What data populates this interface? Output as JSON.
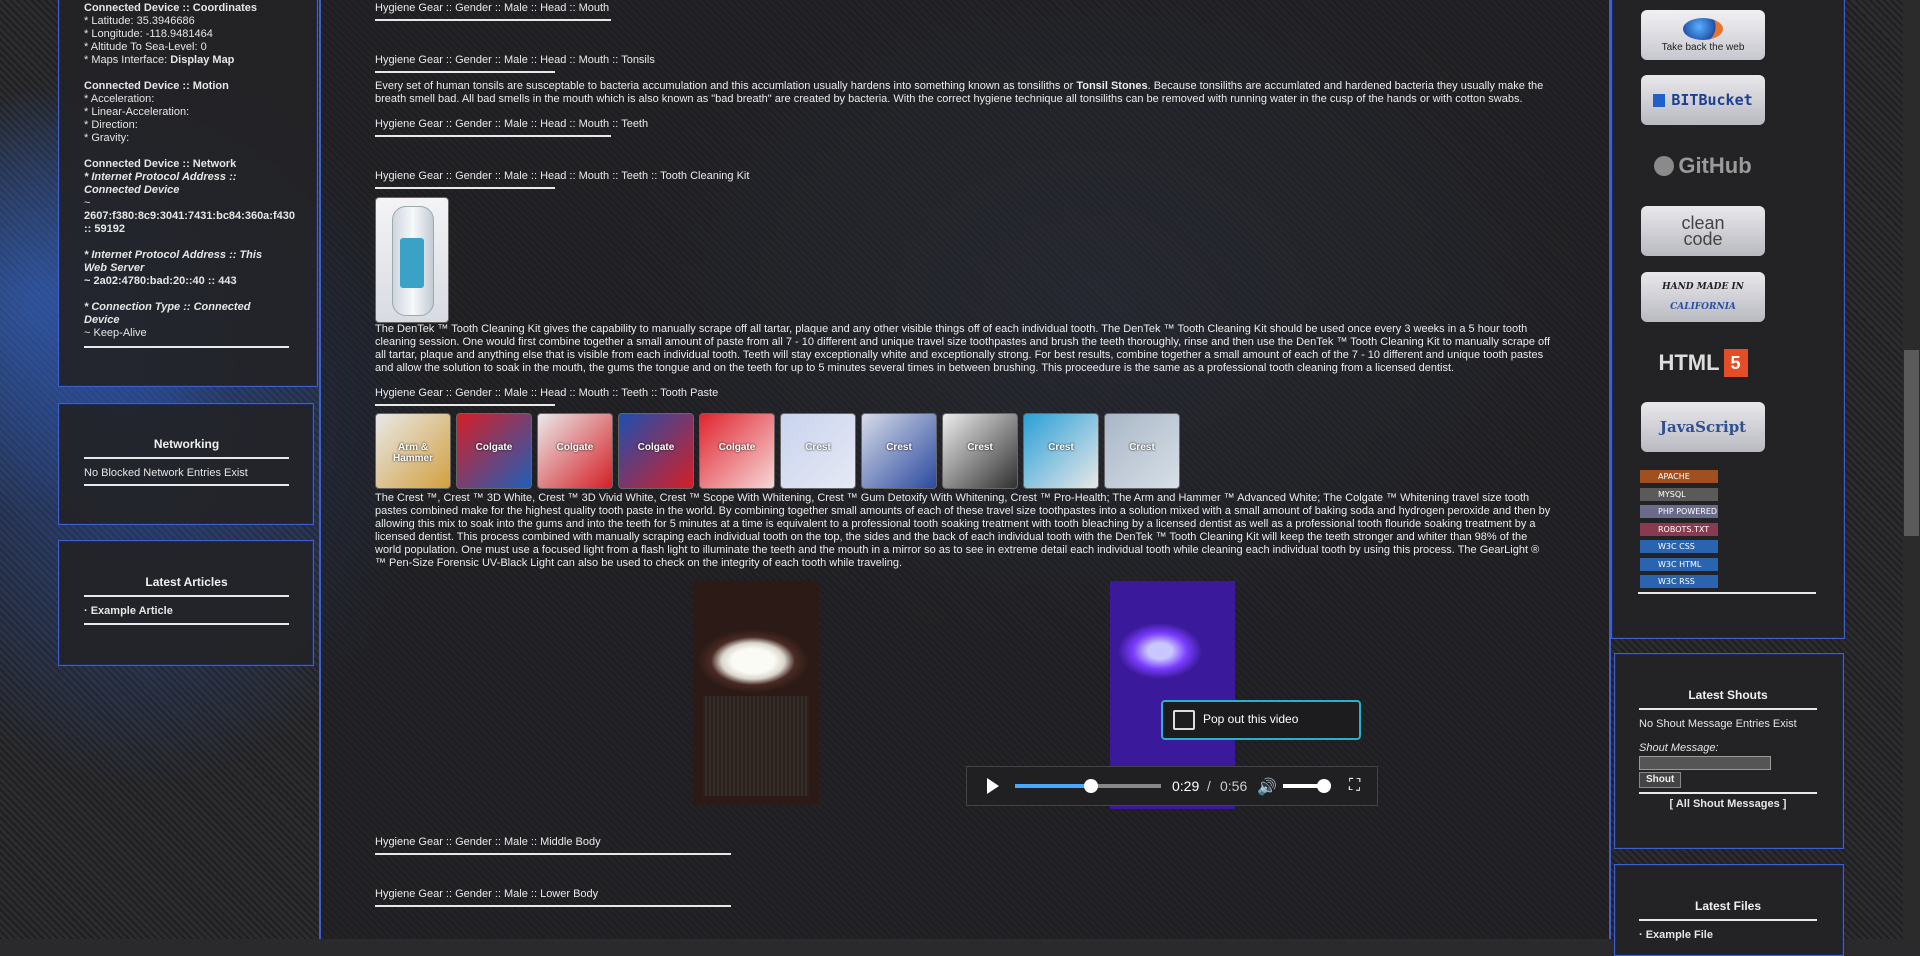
{
  "left": {
    "coords": {
      "title": "Connected Device :: Coordinates",
      "lat": "* Latitude: 35.3946686",
      "lon": "* Longitude: -118.9481464",
      "alt": "* Altitude To Sea-Level: 0",
      "maps_prefix": "* Maps Interface: ",
      "maps_link": "Display Map"
    },
    "motion": {
      "title": "Connected Device :: Motion",
      "items": [
        "* Acceleration:",
        "* Linear-Acceleration:",
        "* Direction:",
        "* Gravity:"
      ]
    },
    "network": {
      "title": "Connected Device :: Network",
      "ip_label_1": "* Internet Protocol Address ::",
      "ip_label_2": "Connected Device",
      "tilde": "~",
      "ip_value_1": "2607:f380:8c9:3041:7431:bc84:360a:f430",
      "ip_value_2": ":: 59192",
      "server_label_1": "* Internet Protocol Address :: This",
      "server_label_2": "Web Server",
      "server_value": "~ 2a02:4780:bad:20::40 :: 443",
      "conn_label_1": "* Connection Type :: Connected",
      "conn_label_2": "Device",
      "conn_value": "~ Keep-Alive"
    },
    "networking": {
      "title": "Networking",
      "text": "No Blocked Network Entries Exist"
    },
    "articles": {
      "title": "Latest Articles",
      "item": "· Example Article"
    }
  },
  "main": {
    "crumb_mouth": "Hygiene Gear :: Gender :: Male :: Head :: Mouth",
    "crumb_tonsils": "Hygiene Gear :: Gender :: Male :: Head :: Mouth :: Tonsils",
    "tonsils_text_1": "Every set of human tonsils are susceptable to bacteria accumulation and this accumlation usually hardens into something known as tonsiliths or ",
    "tonsils_bold": "Tonsil Stones",
    "tonsils_text_2": ". Because tonsiliths are accumlated and hardened bacteria they usually make the breath smell bad. All bad smells in the mouth which is also known as \"bad breath\" are created by bacteria. With the correct hygiene technique all tonsiliths can be removed with running water in the cusp of the hands or with cotton swabs.",
    "crumb_teeth": "Hygiene Gear :: Gender :: Male :: Head :: Mouth :: Teeth",
    "crumb_kit": "Hygiene Gear :: Gender :: Male :: Head :: Mouth :: Teeth :: Tooth Cleaning Kit",
    "kit_text": "The DenTek ™ Tooth Cleaning Kit gives the capability to manually scrape off all tartar, plaque and any other visible things off of each individual tooth. The DenTek ™ Tooth Cleaning Kit should be used once every 3 weeks in a 5 hour tooth cleaning session. One would first combine together a small amount of paste from all 7 - 10 different and unique travel size toothpastes and brush the teeth thoroughly, rinse and then use the DenTek ™ Tooth Cleaning Kit to manually scrape off all tartar, plaque and anything else that is visible from each individual tooth. Teeth will stay exceptionally white and exceptionally strong. For best results, combine together a small amount of each of the 7 - 10 different and unique tooth pastes and allow the solution to soak in the mouth, the gums the tongue and on the teeth for up to 5 minutes several times in between brushing. This proceedure is the same as a professional tooth cleaning from a licensed dentist.",
    "crumb_paste": "Hygiene Gear :: Gender :: Male :: Head :: Mouth :: Teeth :: Tooth Paste",
    "paste_thumbs": [
      "Arm & Hammer",
      "Colgate",
      "Colgate",
      "Colgate",
      "Colgate",
      "Crest",
      "Crest",
      "Crest",
      "Crest",
      "Crest"
    ],
    "paste_text": "The Crest ™, Crest ™ 3D White, Crest ™ 3D Vivid White, Crest ™ Scope With Whitening, Crest ™ Gum Detoxify With Whitening, Crest ™ Pro-Health; The Arm and Hammer ™ Advanced White; The Colgate ™ Whitening travel size tooth pastes combined make for the highest quality tooth paste in the world. By combining together small amounts of each of these travel size toothpastes into a solution mixed with a small amount of baking soda and hydrogen peroxide and then by allowing this mix to soak into the gums and into the teeth for 5 minutes at a time is equivalent to a professional tooth soaking treatment with tooth bleaching by a licensed dentist as well as a professional tooth flouride soaking treatment by a licensed dentist. This process combined with manually scraping each individual tooth on the top, the sides and the back of each individual tooth with the DenTek ™ Tooth Cleaning Kit will keep the teeth stronger and whiter than 98% of the world population. One must use a focused light from a flash light to illuminate the teeth and the mouth in a mirror so as to see in extreme detail each individual tooth while cleaning each individual tooth by using this process. The GearLight ® ™ Pen-Size Forensic UV-Black Light can also be used to check on the integrity of each tooth while traveling.",
    "popout_label": "Pop out this video",
    "video_time": "0:29",
    "video_sep": " / ",
    "video_total": "0:56",
    "video_progress": 0.52,
    "volume_level": 0.85,
    "crumb_middle": "Hygiene Gear :: Gender :: Male :: Middle Body",
    "crumb_lower": "Hygiene Gear :: Gender :: Male :: Lower Body"
  },
  "right": {
    "badges": {
      "firefox": "Take back the web",
      "bitbucket": "BITBucket",
      "github": "GitHub",
      "clean1": "clean",
      "clean2": "code",
      "handmade1": "HAND MADE IN",
      "handmade2": "CALIFORNIA",
      "html5": "HTML",
      "html5_num": "5",
      "javascript": "JavaScript"
    },
    "minis": [
      "APACHE",
      "MYSQL",
      "PHP POWERED",
      "ROBOTS.TXT",
      "W3C CSS",
      "W3C HTML",
      "W3C RSS"
    ],
    "shouts": {
      "title": "Latest Shouts",
      "empty": "No Shout Message Entries Exist",
      "label": "Shout Message:",
      "button": "Shout",
      "all": "[ All Shout Messages ]"
    },
    "files": {
      "title": "Latest Files",
      "item": "· Example File"
    }
  }
}
